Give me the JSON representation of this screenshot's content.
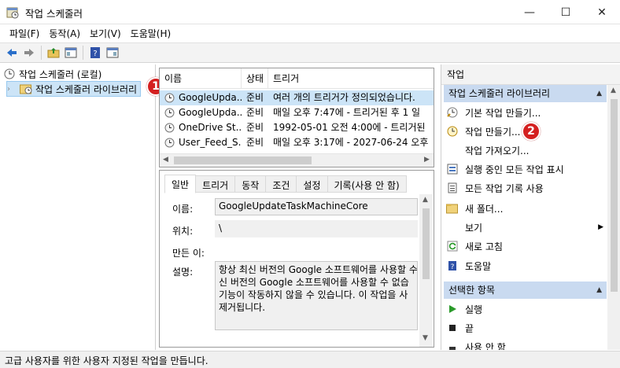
{
  "window": {
    "title": "작업 스케줄러",
    "minimize_glyph": "—",
    "maximize_glyph": "☐",
    "close_glyph": "✕"
  },
  "menu": [
    "파일(F)",
    "동작(A)",
    "보기(V)",
    "도움말(H)"
  ],
  "toolbar": {
    "icons": [
      "back-arrow-icon",
      "forward-arrow-icon",
      "up-folder-icon",
      "show-hide-console-tree-icon",
      "help-icon",
      "show-hide-action-pane-icon"
    ]
  },
  "tree": {
    "root": "작업 스케줄러 (로컬)",
    "child": "작업 스케줄러 라이브러리",
    "child_badge": "1"
  },
  "task_list": {
    "columns": [
      "이름",
      "상태",
      "트리거"
    ],
    "rows": [
      {
        "name": "GoogleUpda...",
        "status": "준비",
        "trigger": "여러 개의 트리거가 정의되었습니다."
      },
      {
        "name": "GoogleUpda...",
        "status": "준비",
        "trigger": "매일 오후 7:47에 - 트리거된 후 1 일"
      },
      {
        "name": "OneDrive St...",
        "status": "준비",
        "trigger": "1992-05-01 오전 4:00에 - 트리거된"
      },
      {
        "name": "User_Feed_S...",
        "status": "준비",
        "trigger": "매일 오후 3:17에 - 2027-06-24 오후"
      }
    ]
  },
  "detail": {
    "tabs": [
      "일반",
      "트리거",
      "동작",
      "조건",
      "설정",
      "기록(사용 안 함)"
    ],
    "name_label": "이름:",
    "name_value": "GoogleUpdateTaskMachineCore",
    "location_label": "위치:",
    "location_value": "\\",
    "author_label": "만든 이:",
    "description_label": "설명:",
    "description_lines": [
      "항상 최신 버전의 Google 소프트웨어를 사용할 수",
      "신 버전의 Google 소프트웨어를 사용할 수 없습",
      "기능이 작동하지 않을 수 있습니다. 이 작업을 사",
      "제거됩니다."
    ]
  },
  "actions": {
    "title": "작업",
    "section1_header": "작업 스케줄러 라이브러리",
    "section1_items": [
      {
        "label": "기본 작업 만들기...",
        "icon": "basic-task-wizard-icon"
      },
      {
        "label": "작업 만들기...",
        "icon": "create-task-icon"
      },
      {
        "label": "작업 가져오기...",
        "icon": ""
      },
      {
        "label": "실행 중인 모든 작업 표시",
        "icon": "running-tasks-icon"
      },
      {
        "label": "모든 작업 기록 사용",
        "icon": "history-icon"
      },
      {
        "label": "새 폴더...",
        "icon": "new-folder-icon"
      },
      {
        "label": "보기",
        "icon": "",
        "submenu": true
      },
      {
        "label": "새로 고침",
        "icon": "refresh-icon"
      },
      {
        "label": "도움말",
        "icon": "help-icon"
      }
    ],
    "create_task_badge": "2",
    "section2_header": "선택한 항목",
    "section2_items": [
      {
        "label": "실행",
        "icon": "run-icon"
      },
      {
        "label": "끝",
        "icon": "end-icon"
      },
      {
        "label": "사용 안 함",
        "icon": "disable-icon"
      }
    ]
  },
  "status_bar": "고급 사용자를 위한 사용자 지정된 작업을 만듭니다.",
  "colors": {
    "selection": "#cce4f7",
    "section_header": "#c9daf0",
    "badge": "#d42020"
  }
}
